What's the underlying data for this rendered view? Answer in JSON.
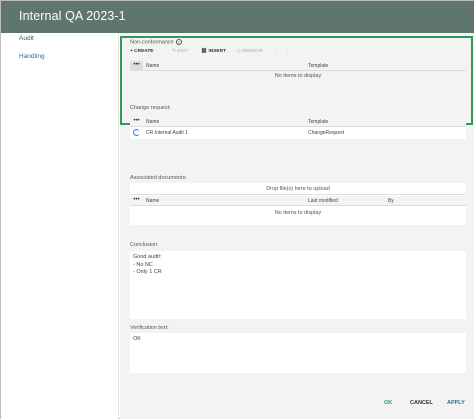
{
  "window": {
    "title": "Internal QA 2023-1"
  },
  "sidebar": {
    "items": [
      {
        "label": "Audit"
      },
      {
        "label": "Handling"
      }
    ]
  },
  "nonconformance": {
    "label": "Non-conformance",
    "info_icon": "?",
    "toolbar": {
      "create": "CREATE",
      "edit": "EDIT",
      "insert": "INSERT",
      "remove": "REMOVE",
      "up": "↑",
      "down": "↓"
    },
    "columns": [
      "Name",
      "Template"
    ],
    "empty": "No items to display"
  },
  "change_request": {
    "label": "Change request:",
    "columns": [
      "Name",
      "Template"
    ],
    "rows": [
      {
        "name": "CR Internal Audit 1",
        "template": "ChangeRequest"
      }
    ]
  },
  "associated_documents": {
    "label": "Associated documents:",
    "dropzone": "Drop file(s) here to upload",
    "columns": [
      "Name",
      "Last modified",
      "By"
    ],
    "empty": "No items to display"
  },
  "conclusion": {
    "label": "Conclusion:",
    "lines": [
      "Good audit:",
      "- No NC",
      "- Only 1 CR"
    ]
  },
  "verification": {
    "label": "Verification text:",
    "value": "OK"
  },
  "footer": {
    "ok": "OK",
    "cancel": "CANCEL",
    "apply": "APPLY"
  },
  "colors": {
    "titlebar": "#5f7570",
    "highlight": "#2e9a57",
    "ok": "#2e9a57",
    "apply": "#2e6d8e",
    "spinner": "#3a7bd5"
  },
  "dots": "•••"
}
